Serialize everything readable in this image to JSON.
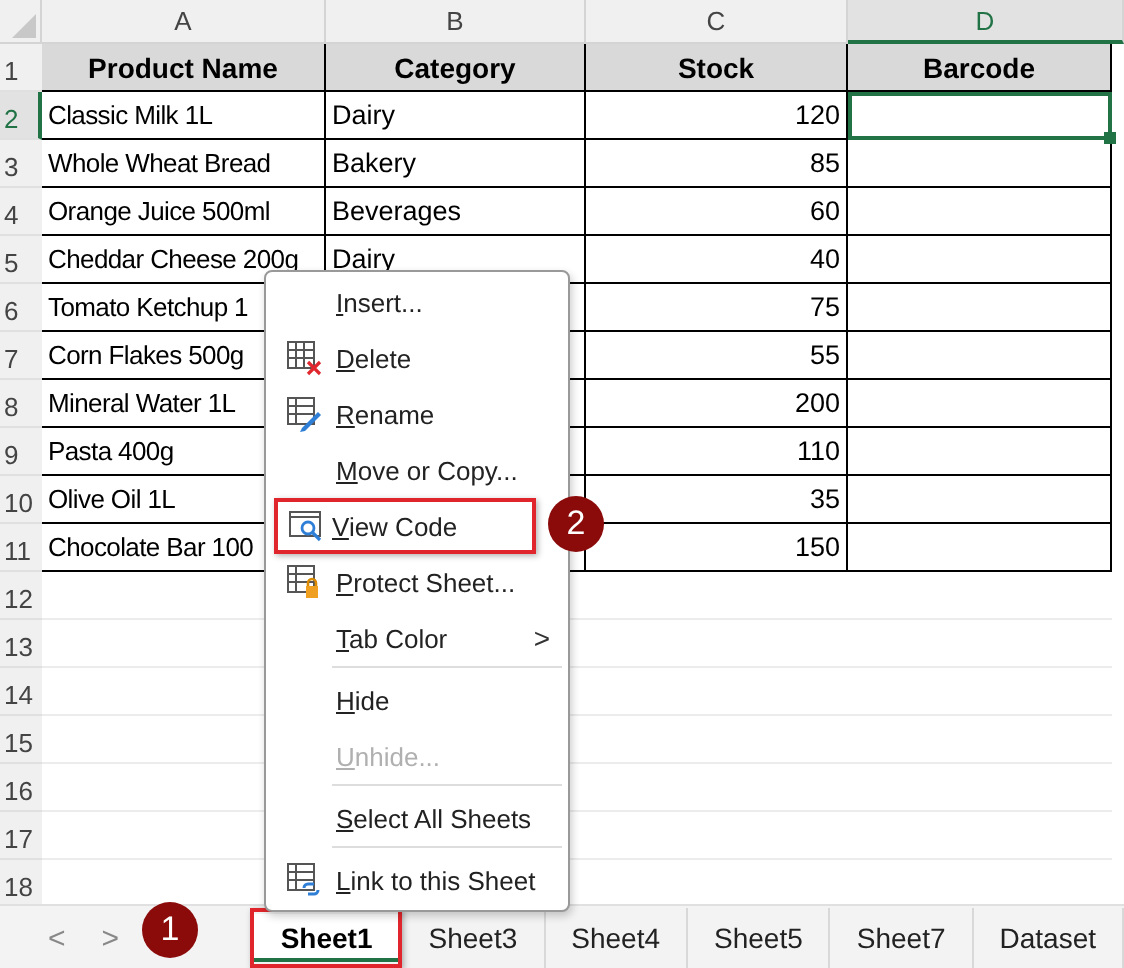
{
  "columns": [
    {
      "letter": "A",
      "selected": false
    },
    {
      "letter": "B",
      "selected": false
    },
    {
      "letter": "C",
      "selected": false
    },
    {
      "letter": "D",
      "selected": true
    }
  ],
  "header": {
    "number": "1",
    "cells": [
      "Product Name",
      "Category",
      "Stock",
      "Barcode"
    ]
  },
  "rows": [
    {
      "number": "2",
      "product": "Classic Milk 1L",
      "category": "Dairy",
      "stock": "120",
      "selected": true
    },
    {
      "number": "3",
      "product": "Whole Wheat Bread",
      "category": "Bakery",
      "stock": "85",
      "selected": false
    },
    {
      "number": "4",
      "product": "Orange Juice 500ml",
      "category": "Beverages",
      "stock": "60",
      "selected": false
    },
    {
      "number": "5",
      "product": "Cheddar Cheese 200g",
      "category": "Dairy",
      "stock": "40",
      "selected": false
    },
    {
      "number": "6",
      "product": "Tomato Ketchup 1",
      "stock": "75",
      "selected": false
    },
    {
      "number": "7",
      "product": "Corn Flakes 500g",
      "stock": "55",
      "selected": false
    },
    {
      "number": "8",
      "product": "Mineral Water 1L",
      "stock": "200",
      "selected": false
    },
    {
      "number": "9",
      "product": "Pasta 400g",
      "stock": "110",
      "selected": false
    },
    {
      "number": "10",
      "product": "Olive Oil 1L",
      "stock": "35",
      "selected": false
    },
    {
      "number": "11",
      "product": "Chocolate Bar 100",
      "stock": "150",
      "selected": false
    }
  ],
  "empty_rows": [
    "12",
    "13",
    "14",
    "15",
    "16",
    "17",
    "18"
  ],
  "context_menu": [
    {
      "label": "Insert...",
      "kind": "plain",
      "disabled": false,
      "submenu": false,
      "separator_before": false,
      "highlighted": false
    },
    {
      "label": "Delete",
      "kind": "delete",
      "disabled": false,
      "submenu": false,
      "separator_before": false,
      "highlighted": false
    },
    {
      "label": "Rename",
      "kind": "rename",
      "disabled": false,
      "submenu": false,
      "separator_before": false,
      "highlighted": false
    },
    {
      "label": "Move or Copy...",
      "kind": "plain",
      "disabled": false,
      "submenu": false,
      "separator_before": false,
      "highlighted": false
    },
    {
      "label": "View Code",
      "kind": "code",
      "disabled": false,
      "submenu": false,
      "separator_before": false,
      "highlighted": true,
      "callout": "2"
    },
    {
      "label": "Protect Sheet...",
      "kind": "protect",
      "disabled": false,
      "submenu": false,
      "separator_before": false,
      "highlighted": false
    },
    {
      "label": "Tab Color",
      "kind": "plain",
      "disabled": false,
      "submenu": true,
      "separator_before": false,
      "highlighted": false
    },
    {
      "label": "Hide",
      "kind": "plain",
      "disabled": false,
      "submenu": false,
      "separator_before": true,
      "highlighted": false
    },
    {
      "label": "Unhide...",
      "kind": "plain",
      "disabled": true,
      "submenu": false,
      "separator_before": false,
      "highlighted": false
    },
    {
      "label": "Select All Sheets",
      "kind": "plain",
      "disabled": false,
      "submenu": false,
      "separator_before": true,
      "highlighted": false
    },
    {
      "label": "Link to this Sheet",
      "kind": "link",
      "disabled": false,
      "submenu": false,
      "separator_before": true,
      "highlighted": false
    }
  ],
  "submenu_arrow": ">",
  "tab_nav": [
    "<",
    ">"
  ],
  "sheet_tabs": [
    {
      "label": "Sheet1",
      "selected": true,
      "highlighted": true,
      "callout": "1"
    },
    {
      "label": "Sheet3",
      "selected": false,
      "highlighted": false
    },
    {
      "label": "Sheet4",
      "selected": false,
      "highlighted": false
    },
    {
      "label": "Sheet5",
      "selected": false,
      "highlighted": false
    },
    {
      "label": "Sheet7",
      "selected": false,
      "highlighted": false
    },
    {
      "label": "Dataset",
      "selected": false,
      "highlighted": false
    }
  ]
}
